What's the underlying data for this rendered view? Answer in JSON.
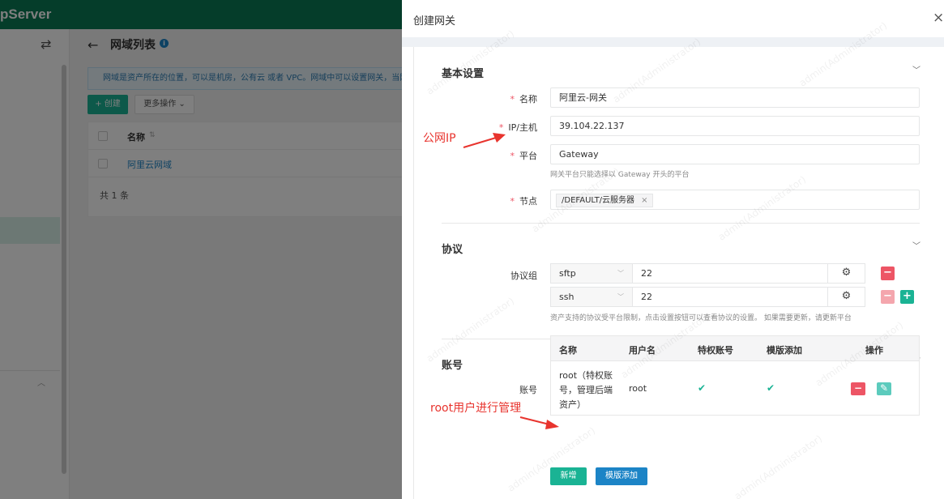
{
  "background": {
    "brand": "pServer",
    "page_title": "网域列表",
    "notice": "网域是资产所在的位置，可以是机房，公有云 或者 VPC。网域中可以设置网关，当网",
    "create_button": "+ 创建",
    "more_button": "更多操作",
    "table": {
      "header_name": "名称",
      "rows": [
        "阿里云网域"
      ],
      "total": "共 1 条"
    }
  },
  "drawer": {
    "title": "创建网关",
    "close_glyph": "×",
    "basic": {
      "title": "基本设置",
      "name_label": "名称",
      "name_value": "阿里云-网关",
      "ip_label": "IP/主机",
      "ip_value": "39.104.22.137",
      "platform_label": "平台",
      "platform_value": "Gateway",
      "platform_help": "网关平台只能选择以 Gateway 开头的平台",
      "node_label": "节点",
      "node_tag": "/DEFAULT/云服务器"
    },
    "protocol": {
      "title": "协议",
      "group_label": "协议组",
      "rows": [
        {
          "protocol": "sftp",
          "port": "22"
        },
        {
          "protocol": "ssh",
          "port": "22"
        }
      ],
      "help": "资产支持的协议受平台限制，点击设置按钮可以查看协议的设置。 如果需要更新，请更新平台"
    },
    "account": {
      "title": "账号",
      "label": "账号",
      "headers": {
        "name": "名称",
        "username": "用户名",
        "privileged": "特权账号",
        "template_add": "模版添加",
        "actions": "操作"
      },
      "rows": [
        {
          "name": "root（特权账号，管理后端资产）",
          "username": "root",
          "privileged": true,
          "template_add": true
        }
      ],
      "add_button": "新增",
      "template_button": "模版添加"
    }
  },
  "annotations": {
    "public_ip": "公网IP",
    "root_user": "root用户进行管理"
  },
  "watermark": "admin(Administrator)",
  "colors": {
    "brand_green": "#0b7a55",
    "primary": "#1ab394",
    "blue": "#1c84c6",
    "danger": "#ed5565",
    "annotation_red": "#e8342e"
  }
}
